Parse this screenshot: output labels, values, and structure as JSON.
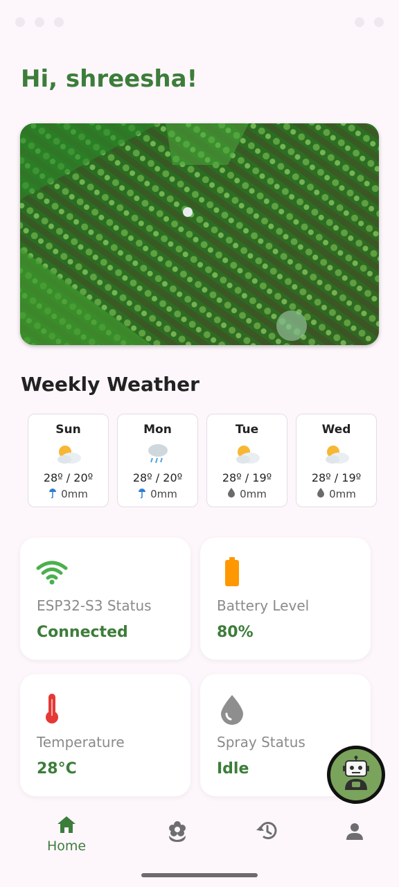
{
  "greeting": "Hi, shreesha!",
  "weather": {
    "title": "Weekly Weather",
    "days": [
      {
        "day": "Sun",
        "icon": "sun-behind-cloud-icon",
        "temps": "28º / 20º",
        "rain": "0mm",
        "rain_icon": "umbrella-icon"
      },
      {
        "day": "Mon",
        "icon": "rain-cloud-icon",
        "temps": "28º / 20º",
        "rain": "0mm",
        "rain_icon": "umbrella-icon"
      },
      {
        "day": "Tue",
        "icon": "sun-behind-cloud-icon",
        "temps": "28º / 19º",
        "rain": "0mm",
        "rain_icon": "droplet-icon"
      },
      {
        "day": "Wed",
        "icon": "sun-behind-cloud-icon",
        "temps": "28º / 19º",
        "rain": "0mm",
        "rain_icon": "droplet-icon"
      }
    ]
  },
  "tiles": {
    "esp": {
      "label": "ESP32-S3 Status",
      "value": "Connected",
      "icon": "wifi-icon"
    },
    "battery": {
      "label": "Battery Level",
      "value": "80%",
      "icon": "battery-icon"
    },
    "temperature": {
      "label": "Temperature",
      "value": "28°C",
      "icon": "thermometer-icon"
    },
    "spray": {
      "label": "Spray Status",
      "value": "Idle",
      "icon": "water-drop-icon"
    }
  },
  "nav": {
    "home_label": "Home"
  },
  "colors": {
    "accent_green": "#3d7d3a",
    "wifi_green": "#4caf50",
    "battery_orange": "#ff9800",
    "thermo_red": "#e53935",
    "drop_gray": "#8e8e8e",
    "background": "#fdf7fc"
  }
}
